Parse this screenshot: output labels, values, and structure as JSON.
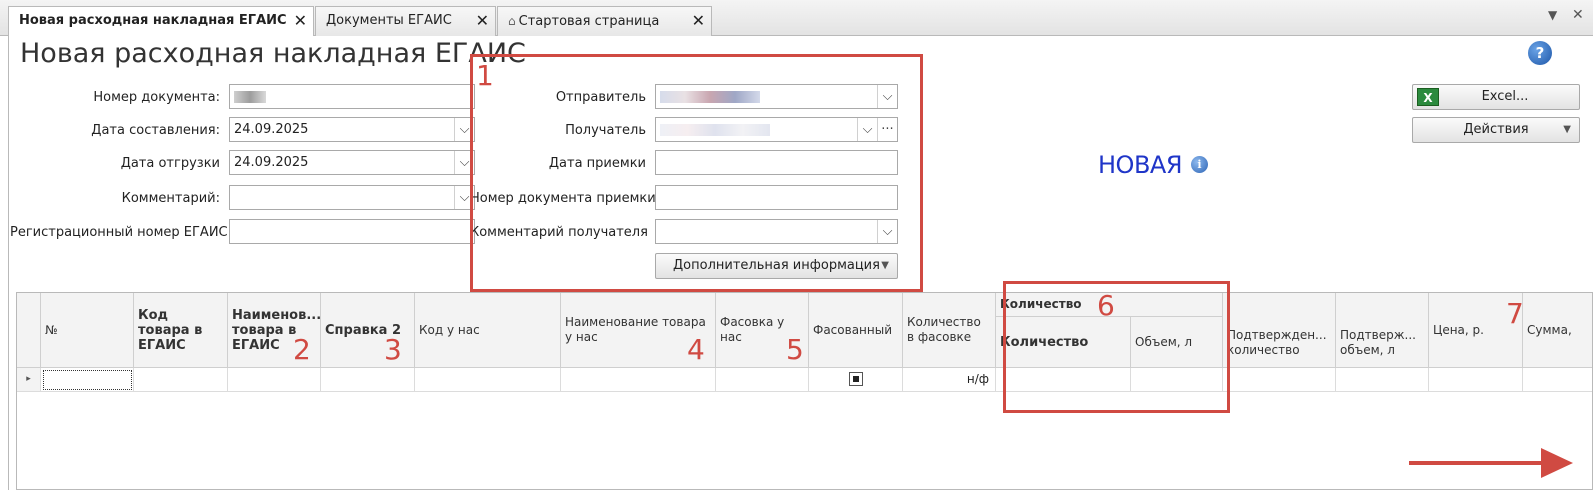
{
  "tabs": [
    {
      "label": "Новая расходная накладная ЕГАИС",
      "close": "✕"
    },
    {
      "label": "Документы ЕГАИС",
      "close": "✕"
    },
    {
      "label": "Стартовая страница",
      "close": "✕"
    }
  ],
  "tab_controls": {
    "menu": "▼",
    "close": "✕"
  },
  "page": {
    "title": "Новая расходная накладная ЕГАИС",
    "help": "?"
  },
  "left_form": {
    "doc_number": {
      "label": "Номер документа:",
      "value": ""
    },
    "date_created": {
      "label": "Дата составления:",
      "value": "24.09.2025"
    },
    "date_shipped": {
      "label": "Дата отгрузки",
      "value": "24.09.2025"
    },
    "comment": {
      "label": "Комментарий:",
      "value": ""
    },
    "egais_reg_number": {
      "label": "Регистрационный номер ЕГАИС:",
      "value": ""
    }
  },
  "recipient_form": {
    "sender": {
      "label": "Отправитель",
      "value": ""
    },
    "recipient": {
      "label": "Получатель",
      "value": "",
      "more": "···"
    },
    "accept_date": {
      "label": "Дата приемки",
      "value": ""
    },
    "accept_doc_number": {
      "label": "Номер документа приемки",
      "value": ""
    },
    "recipient_comment": {
      "label": "Комментарий получателя",
      "value": ""
    },
    "extra_info_button": "Дополнительная информация"
  },
  "actions": {
    "excel": "Excel...",
    "excel_icon": "X",
    "actions": "Действия"
  },
  "status": {
    "text": "НОВАЯ",
    "info_icon": "i"
  },
  "grid": {
    "headers": {
      "num": "№",
      "egais_code": "Код товара в ЕГАИС",
      "egais_name": "Наименов... товара в ЕГАИС",
      "spravka2": "Справка 2",
      "our_code": "Код у нас",
      "our_name": "Наименование товара у нас",
      "our_packing": "Фасовка у нас",
      "packed": "Фасованный",
      "qty_in_pack": "Количество в фасовке",
      "qty_group": "Количество",
      "qty": "Количество",
      "volume": "Объем, л",
      "confirmed_qty": "Подтвержден... количество",
      "confirmed_volume": "Подтверж... объем, л",
      "price": "Цена, р.",
      "sum": "Сумма,"
    },
    "row": {
      "marker": "▸",
      "qty_in_pack": "н/ф"
    }
  },
  "annotations": [
    "1",
    "2",
    "3",
    "4",
    "5",
    "6",
    "7"
  ],
  "colors": {
    "annotation": "#d04a42",
    "status": "#1f35c8"
  }
}
